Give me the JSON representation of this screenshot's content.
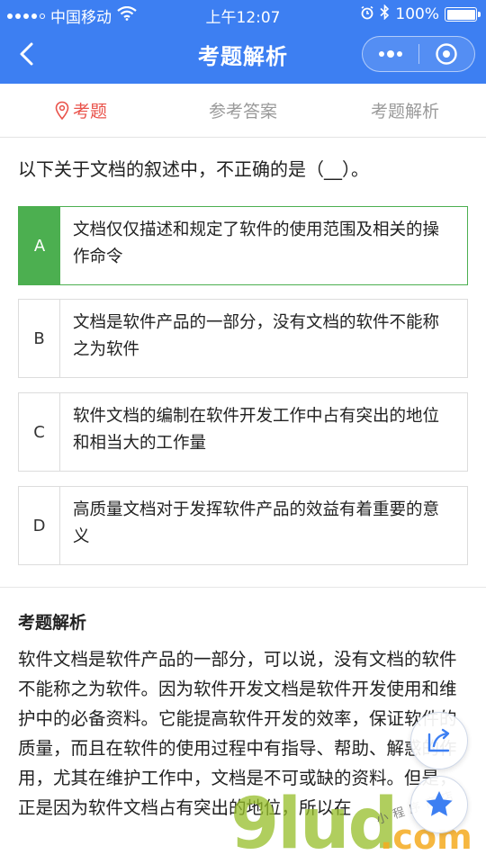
{
  "status_bar": {
    "carrier": "中国移动",
    "time": "上午12:07",
    "battery": "100%",
    "battery_level": 1.0
  },
  "nav": {
    "title": "考题解析"
  },
  "tabs": [
    {
      "label": "考题",
      "active": true
    },
    {
      "label": "参考答案",
      "active": false
    },
    {
      "label": "考题解析",
      "active": false
    }
  ],
  "question": {
    "text": "以下关于文档的叙述中，不正确的是（__）。",
    "options": [
      {
        "letter": "A",
        "text": "文档仅仅描述和规定了软件的使用范围及相关的操作命令",
        "correct": true
      },
      {
        "letter": "B",
        "text": "文档是软件产品的一部分，没有文档的软件不能称之为软件",
        "correct": false
      },
      {
        "letter": "C",
        "text": "软件文档的编制在软件开发工作中占有突出的地位和相当大的工作量",
        "correct": false
      },
      {
        "letter": "D",
        "text": "高质量文档对于发挥软件产品的效益有着重要的意义",
        "correct": false
      }
    ]
  },
  "analysis": {
    "title": "考题解析",
    "body": "软件文档是软件产品的一部分，可以说，没有文档的软件不能称之为软件。因为软件开发文档是软件开发使用和维护中的必备资料。它能提高软件开发的效率，保证软件的质量，而且在软件的使用过程中有指导、帮助、解惑的作用，尤其在维护工作中，文档是不可或缺的资料。但是，正是因为软件文档占有突出的地位，所以在"
  },
  "watermark": {
    "main": "9lud",
    "suffix": ".com",
    "small": "小程序商店"
  },
  "colors": {
    "header": "#3d7ff2",
    "active_tab": "#e9524a",
    "correct": "#4caf50"
  }
}
